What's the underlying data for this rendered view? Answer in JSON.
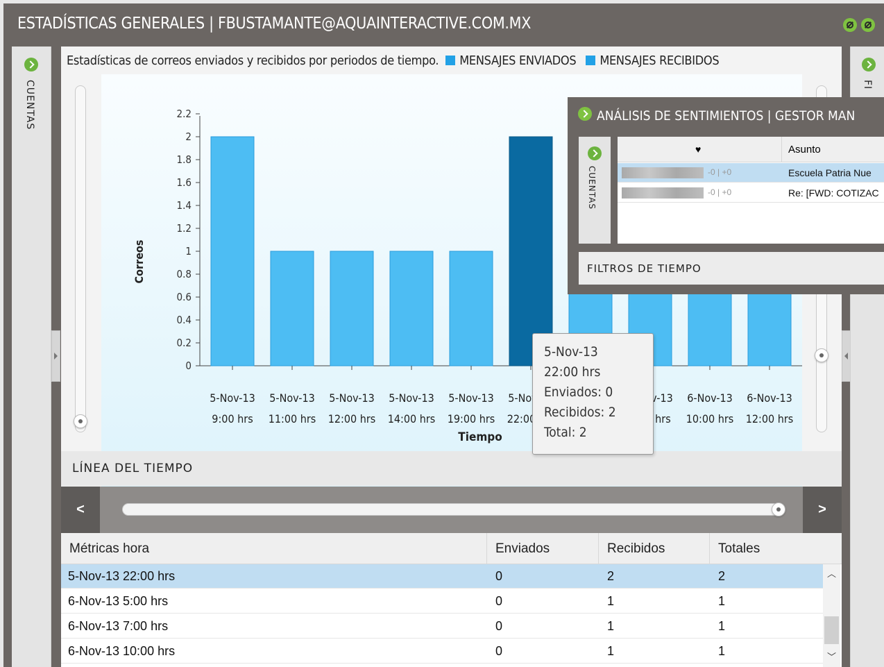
{
  "window": {
    "title": "ESTADÍSTICAS GENERALES | FBUSTAMANTE@AQUAINTERACTIVE.COM.MX"
  },
  "left_sidebar": {
    "label": "CUENTAS"
  },
  "right_sidebar": {
    "label": "FI"
  },
  "chart_header": {
    "description": "Estadísticas de correos enviados y recibidos por periodos de tiempo.",
    "legend": [
      {
        "label": "MENSAJES ENVIADOS",
        "color": "#22a1e6"
      },
      {
        "label": "MENSAJES RECIBIDOS",
        "color": "#22a1e6"
      }
    ]
  },
  "chart_data": {
    "type": "bar",
    "title": "",
    "xlabel": "Tiempo",
    "ylabel": "Correos",
    "ylim": [
      0,
      2.2
    ],
    "yticks": [
      "0",
      "0.2",
      "0.4",
      "0.6",
      "0.8",
      "1",
      "1.2",
      "1.4",
      "1.6",
      "1.8",
      "2",
      "2.2"
    ],
    "categories": [
      [
        "5-Nov-13",
        "9:00 hrs"
      ],
      [
        "5-Nov-13",
        "11:00 hrs"
      ],
      [
        "5-Nov-13",
        "12:00 hrs"
      ],
      [
        "5-Nov-13",
        "14:00 hrs"
      ],
      [
        "5-Nov-13",
        "19:00 hrs"
      ],
      [
        "5-Nov-13",
        "22:00 hrs"
      ],
      [
        "6-Nov-13",
        "5:00 hrs"
      ],
      [
        "6-Nov-13",
        "7:00 hrs"
      ],
      [
        "6-Nov-13",
        "10:00 hrs"
      ],
      [
        "6-Nov-13",
        "12:00 hrs"
      ]
    ],
    "values": [
      2,
      1,
      1,
      1,
      1,
      2,
      1,
      1,
      1,
      1
    ],
    "highlighted_index": 5,
    "bar_color": "#4dbdf3",
    "highlight_color": "#0a6aa1",
    "grid": false
  },
  "tooltip": {
    "lines": [
      "5-Nov-13",
      "22:00 hrs",
      "Enviados: 0",
      "Recibidos: 2",
      "Total: 2"
    ]
  },
  "timeline": {
    "title": "LÍNEA DEL TIEMPO",
    "prev_label": "<",
    "next_label": ">"
  },
  "table": {
    "headers": [
      "Métricas hora",
      "Enviados",
      "Recibidos",
      "Totales"
    ],
    "rows": [
      [
        "5-Nov-13 22:00 hrs",
        "0",
        "2",
        "2"
      ],
      [
        "6-Nov-13 5:00 hrs",
        "0",
        "1",
        "1"
      ],
      [
        "6-Nov-13 7:00 hrs",
        "0",
        "1",
        "1"
      ],
      [
        "6-Nov-13 10:00 hrs",
        "0",
        "1",
        "1"
      ]
    ],
    "selected_row": 0
  },
  "sentiment_window": {
    "title": "ANÁLISIS DE SENTIMIENTOS | GESTOR MAN",
    "side_label": "CUENTAS",
    "header_icon": "heart-icon",
    "header_subject": "Asunto",
    "rows": [
      {
        "score": "-0 | +0",
        "subject": "Escuela Patria Nue"
      },
      {
        "score": "-0 | +0",
        "subject": "Re: [FWD: COTIZAC"
      }
    ],
    "filter_title": "FILTROS DE TIEMPO"
  }
}
